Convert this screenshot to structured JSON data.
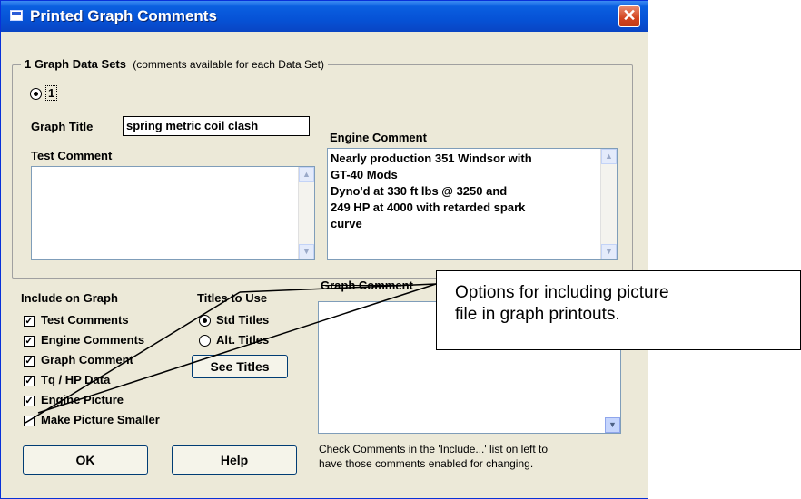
{
  "window": {
    "title": "Printed Graph Comments",
    "close_glyph": "✕",
    "title_icon": "app-window-icon"
  },
  "data_sets": {
    "header": "1 Graph Data Sets",
    "note": "(comments available for each Data Set)",
    "options": [
      {
        "label": "1",
        "selected": true
      }
    ]
  },
  "graph_title": {
    "label": "Graph Title",
    "value": "spring metric coil clash"
  },
  "test_comment": {
    "label": "Test Comment",
    "value": ""
  },
  "engine_comment": {
    "label": "Engine Comment",
    "value": "Nearly production 351 Windsor with\nGT-40 Mods\nDyno'd at 330 ft lbs @ 3250 and\n249 HP at 4000 with retarded spark\ncurve"
  },
  "include_on_graph": {
    "label": "Include on Graph",
    "items": [
      {
        "label": "Test Comments",
        "checked": true
      },
      {
        "label": "Engine Comments",
        "checked": true
      },
      {
        "label": "Graph Comment",
        "checked": true
      },
      {
        "label": "Tq / HP Data",
        "checked": true
      },
      {
        "label": "Engine Picture",
        "checked": true
      },
      {
        "label": "Make Picture Smaller",
        "checked": false
      }
    ]
  },
  "titles_to_use": {
    "label": "Titles to Use",
    "options": [
      {
        "label": "Std Titles",
        "selected": true
      },
      {
        "label": "Alt. Titles",
        "selected": false
      }
    ],
    "see_titles_button": "See Titles"
  },
  "graph_comment": {
    "label": "Graph Comment",
    "value": ""
  },
  "help_text": "Check Comments in the 'Include...' list on left to\nhave those comments enabled for changing.",
  "buttons": {
    "ok": "OK",
    "help": "Help"
  },
  "callout": {
    "text": "Options for including picture\nfile in graph printouts."
  },
  "colors": {
    "dialog_bg": "#ECE9D8",
    "titlebar": "#0A5FE0",
    "close_button": "#D2441F"
  }
}
